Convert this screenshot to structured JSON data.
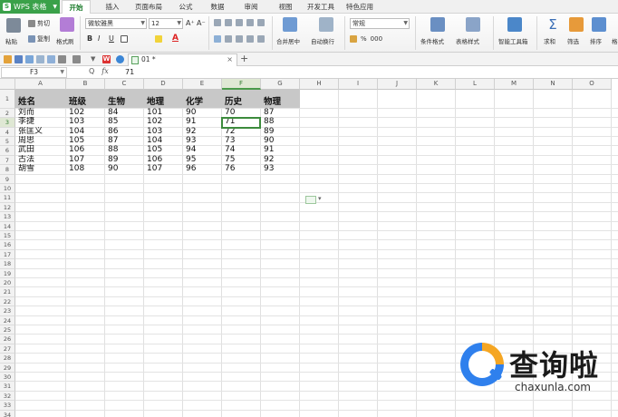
{
  "app": {
    "name": "WPS 表格",
    "logo": "S"
  },
  "menu": [
    "开始",
    "插入",
    "页面布局",
    "公式",
    "数据",
    "审阅",
    "视图",
    "开发工具",
    "特色应用"
  ],
  "ribbon": {
    "paste": "粘贴",
    "cut": "剪切",
    "copy": "复制",
    "format_painter": "格式刷",
    "font_name": "微软雅黑",
    "font_size": "12",
    "number_format": "常规",
    "merge_center": "合并居中",
    "wrap_text": "自动换行",
    "conditional_format": "条件格式",
    "table_style": "表格样式",
    "smart_toolbox": "智能工具箱",
    "sum": "求和",
    "filter": "筛选",
    "sort": "排序",
    "format": "格式",
    "font_grow": "A⁺",
    "font_shrink": "A⁻",
    "bold": "B",
    "italic": "I",
    "underline": "U",
    "font_color": "A",
    "percent": "%",
    "thousands": "000"
  },
  "doc_tab": {
    "name": "01 *"
  },
  "formula_bar": {
    "cell_ref": "F3",
    "fx": "fx",
    "search": "Q",
    "value": "71"
  },
  "columns": [
    "A",
    "B",
    "C",
    "D",
    "E",
    "F",
    "G",
    "H",
    "I",
    "J",
    "K",
    "L",
    "M",
    "N",
    "O"
  ],
  "rows": [
    "1",
    "2",
    "3",
    "4",
    "5",
    "6",
    "7",
    "8",
    "9",
    "10",
    "11",
    "12",
    "13",
    "14",
    "15",
    "16",
    "17",
    "18",
    "19",
    "20",
    "21",
    "22",
    "23",
    "24",
    "25",
    "26",
    "27",
    "28",
    "29",
    "30",
    "31",
    "32",
    "33",
    "34"
  ],
  "sheet": {
    "header": [
      "姓名",
      "班级",
      "生物",
      "地理",
      "化学",
      "历史",
      "物理"
    ],
    "data": [
      [
        "刘而",
        "102",
        "84",
        "101",
        "90",
        "70",
        "87"
      ],
      [
        "李捷",
        "103",
        "85",
        "102",
        "91",
        "71",
        "88"
      ],
      [
        "张匡义",
        "104",
        "86",
        "103",
        "92",
        "72",
        "89"
      ],
      [
        "周思",
        "105",
        "87",
        "104",
        "93",
        "73",
        "90"
      ],
      [
        "武田",
        "106",
        "88",
        "105",
        "94",
        "74",
        "91"
      ],
      [
        "古法",
        "107",
        "89",
        "106",
        "95",
        "75",
        "92"
      ],
      [
        "胡雪",
        "108",
        "90",
        "107",
        "96",
        "76",
        "93"
      ]
    ]
  },
  "watermark": {
    "brand": "查询啦",
    "url": "chaxunla.com"
  }
}
